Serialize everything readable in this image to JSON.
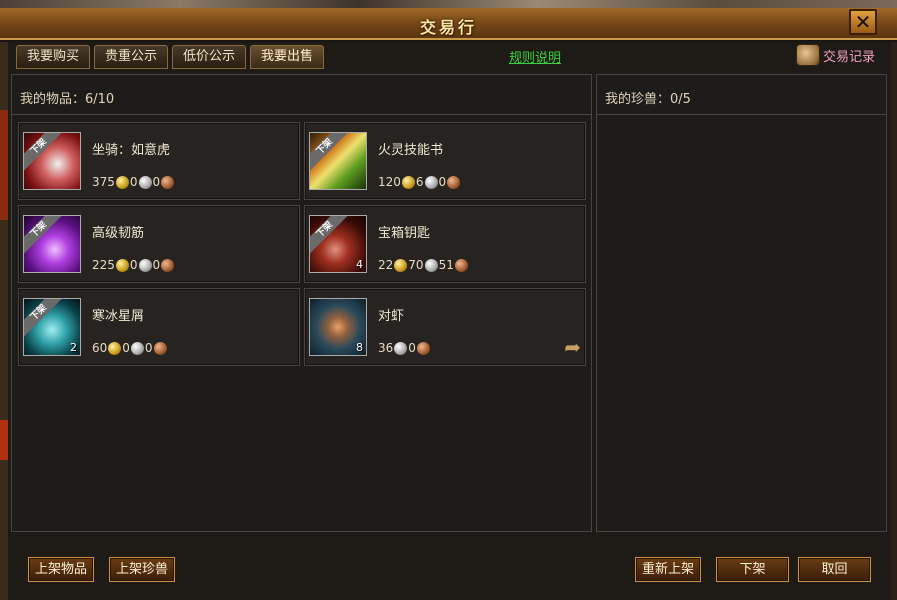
{
  "window": {
    "title": "交易行"
  },
  "tabs": [
    {
      "label": "我要购买"
    },
    {
      "label": "贵重公示"
    },
    {
      "label": "低价公示"
    },
    {
      "label": "我要出售"
    }
  ],
  "rules_link": "规则说明",
  "trade_record": "交易记录",
  "my_items": {
    "label": "我的物品：6/10"
  },
  "my_pets": {
    "label": "我的珍兽：0/5"
  },
  "items": [
    {
      "name": "坐骑：如意虎",
      "gold": "375",
      "silver": "0",
      "copper": "0",
      "qty": "",
      "ribbon": "下架",
      "icon": "tiger-mount-icon"
    },
    {
      "name": "火灵技能书",
      "gold": "120",
      "silver": "6",
      "copper": "0",
      "qty": "",
      "ribbon": "下架",
      "icon": "fire-skill-book-icon"
    },
    {
      "name": "高级韧筋",
      "gold": "225",
      "silver": "0",
      "copper": "0",
      "qty": "",
      "ribbon": "下架",
      "icon": "tendon-icon"
    },
    {
      "name": "宝箱钥匙",
      "gold": "22",
      "silver": "70",
      "copper": "51",
      "qty": "4",
      "ribbon": "下架",
      "icon": "chest-key-icon"
    },
    {
      "name": "寒冰星屑",
      "gold": "60",
      "silver": "0",
      "copper": "0",
      "qty": "2",
      "ribbon": "下架",
      "icon": "ice-stardust-icon"
    },
    {
      "name": "对虾",
      "gold": "",
      "silver": "36",
      "copper": "0",
      "qty": "8",
      "ribbon": "",
      "icon": "shrimp-icon"
    }
  ],
  "buttons": {
    "list_item": "上架物品",
    "list_pet": "上架珍兽",
    "relist": "重新上架",
    "delist": "下架",
    "cancel": "取回"
  },
  "colors": {
    "rules_link": "#3ad23a",
    "trade_record": "#f0a0c0",
    "title": "#ffe7a0"
  }
}
